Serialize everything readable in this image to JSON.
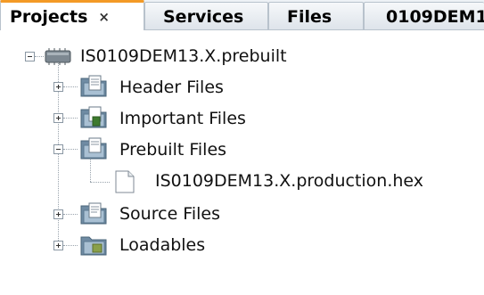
{
  "tabs": [
    {
      "label": "Projects",
      "close": "×",
      "active": true
    },
    {
      "label": "Services"
    },
    {
      "label": "Files"
    },
    {
      "label": "0109DEM1"
    }
  ],
  "tree": {
    "project": {
      "label": "IS0109DEM13.X.prebuilt",
      "icon": "project-chip-icon",
      "expanded": true
    },
    "folders": [
      {
        "label": "Header Files",
        "icon": "header-folder-icon",
        "expanded": false
      },
      {
        "label": "Important Files",
        "icon": "important-folder-icon",
        "expanded": false
      },
      {
        "label": "Prebuilt Files",
        "icon": "prebuilt-folder-icon",
        "expanded": true,
        "children": [
          {
            "label": "IS0109DEM13.X.production.hex",
            "icon": "file-icon"
          }
        ]
      },
      {
        "label": "Source Files",
        "icon": "source-folder-icon",
        "expanded": false
      },
      {
        "label": "Loadables",
        "icon": "loadables-folder-icon",
        "expanded": false
      }
    ]
  },
  "colors": {
    "active_tab_accent": "#f39a26",
    "folder": "#8fa8be"
  }
}
